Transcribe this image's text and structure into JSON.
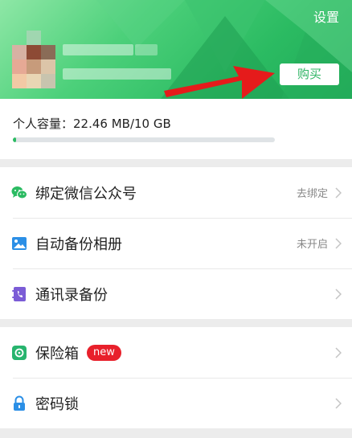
{
  "header": {
    "settings_label": "设置",
    "buy_label": "购买",
    "colors": {
      "brand": "#2bbb62"
    }
  },
  "storage": {
    "label": "个人容量：22.46 MB/10 GB",
    "used_fraction": 0.0022
  },
  "menu_group_1": [
    {
      "label": "绑定微信公众号",
      "status": "去绑定",
      "icon": "wechat-icon"
    },
    {
      "label": "自动备份相册",
      "status": "未开启",
      "icon": "photo-album-icon"
    },
    {
      "label": "通讯录备份",
      "status": "",
      "icon": "contacts-icon"
    }
  ],
  "menu_group_2": [
    {
      "label": "保险箱",
      "badge": "new",
      "icon": "safe-box-icon"
    },
    {
      "label": "密码锁",
      "icon": "lock-icon"
    }
  ]
}
